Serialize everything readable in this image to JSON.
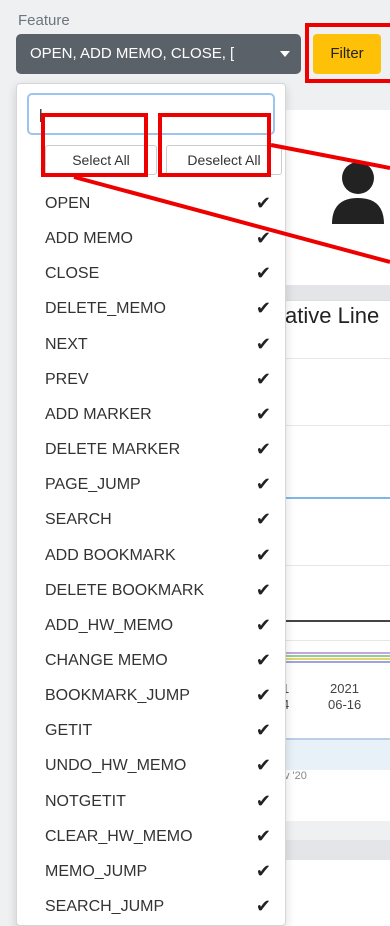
{
  "feature_label": "Feature",
  "feature_value": "OPEN, ADD MEMO, CLOSE, [",
  "filter_label": "Filter",
  "search": {
    "value": "|",
    "placeholder": ""
  },
  "select_all_label": "Select All",
  "deselect_all_label": "Deselect All",
  "options": [
    "OPEN",
    "ADD MEMO",
    "CLOSE",
    "DELETE_MEMO",
    "NEXT",
    "PREV",
    "ADD MARKER",
    "DELETE MARKER",
    "PAGE_JUMP",
    "SEARCH",
    "ADD BOOKMARK",
    "DELETE BOOKMARK",
    "ADD_HW_MEMO",
    "CHANGE MEMO",
    "BOOKMARK_JUMP",
    "GETIT",
    "UNDO_HW_MEMO",
    "NOTGETIT",
    "CLEAR_HW_MEMO",
    "MEMO_JUMP",
    "SEARCH_JUMP"
  ],
  "check_glyph": "✔",
  "background": {
    "chart_title": "ative Line",
    "tick_a": "1",
    "tick_b": "4",
    "tick_year": "2021",
    "tick_date": "06-16",
    "tick_minor": "v '20"
  },
  "colors": {
    "accent_filter": "#ffc107",
    "select_bg": "#5b6169",
    "annotation_red": "#e00000"
  }
}
